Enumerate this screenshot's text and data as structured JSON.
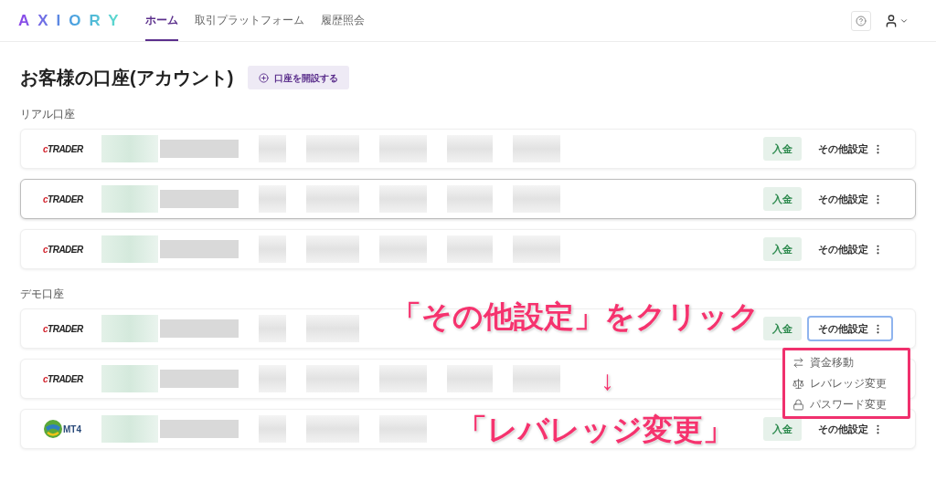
{
  "header": {
    "logo": "AXIORY",
    "nav": [
      {
        "label": "ホーム",
        "selected": true
      },
      {
        "label": "取引プラットフォーム",
        "selected": false
      },
      {
        "label": "履歴照会",
        "selected": false
      }
    ]
  },
  "page": {
    "title": "お客様の口座(アカウント)",
    "open_account_button": "口座を開設する"
  },
  "sections": [
    {
      "label": "リアル口座",
      "accounts": [
        {
          "kind": "ctrader",
          "platform_label": "cTRADER",
          "deposit_button": "入金",
          "settings_button": "その他設定",
          "highlighted": false,
          "menu_open": false
        },
        {
          "kind": "ctrader",
          "platform_label": "cTRADER",
          "deposit_button": "入金",
          "settings_button": "その他設定",
          "highlighted": true,
          "menu_open": false
        },
        {
          "kind": "ctrader",
          "platform_label": "cTRADER",
          "deposit_button": "入金",
          "settings_button": "その他設定",
          "highlighted": false,
          "menu_open": false
        }
      ]
    },
    {
      "label": "デモ口座",
      "accounts": [
        {
          "kind": "ctrader",
          "platform_label": "cTRADER",
          "deposit_button": "入金",
          "settings_button": "その他設定",
          "highlighted": false,
          "menu_open": true
        },
        {
          "kind": "ctrader",
          "platform_label": "cTRADER",
          "highlighted": false,
          "menu_open": false
        },
        {
          "kind": "mt4",
          "platform_label": "MT4",
          "deposit_button": "入金",
          "settings_button": "その他設定",
          "highlighted": false,
          "menu_open": false
        }
      ]
    }
  ],
  "settings_menu": [
    {
      "kind": "transfer",
      "label": "資金移動"
    },
    {
      "kind": "scale",
      "label": "レバレッジ変更"
    },
    {
      "kind": "lock",
      "label": "パスワード変更"
    }
  ],
  "annotations": {
    "instruction": "「その他設定」をクリック",
    "arrow": "↓",
    "target": "「レバレッジ変更」"
  }
}
